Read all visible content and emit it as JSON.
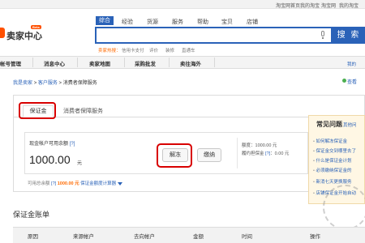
{
  "top_links": [
    "淘宝网首页",
    "我的淘宝",
    "淘宝网",
    "我的淘宝"
  ],
  "logo": {
    "text": "卖家中心",
    "badge": "Beta"
  },
  "search": {
    "tabs": [
      "综合",
      "经验",
      "货源",
      "服务",
      "帮助",
      "宝贝",
      "店铺"
    ],
    "button": "搜 索",
    "hot_label": "卖家热搜：",
    "hot_words": [
      "信用卡支付",
      "评价",
      "装修",
      "直通车"
    ]
  },
  "nav": {
    "items": [
      "帐号管理",
      "消息中心",
      "卖家地图",
      "采购批发",
      "卖往海外"
    ],
    "right_link": "我的"
  },
  "breadcrumb": [
    "我是卖家",
    "客户服务",
    "消费者保障服务"
  ],
  "help_link": "查看",
  "tabs": {
    "deposit": "保证金",
    "consumer": "消费者保障服务"
  },
  "account": {
    "available_label": "现金帐户可用余额",
    "available_hint": "[?]",
    "amount": "1000.00",
    "unit": "元",
    "unfreeze_button": "解冻",
    "pay_button": "缴纳",
    "quota_label": "额度：",
    "quota_value": "1000.00 元",
    "perform_label": "履约担保金",
    "perform_hint": "[?]",
    "perform_value": "：0.00 元"
  },
  "bottom": {
    "label": "可用总余额",
    "hint": "[?]",
    "amount": "1000.00 元",
    "calc_link": "保证金额度计算器"
  },
  "faq": {
    "title": "常见问题",
    "more": "其他问",
    "items": [
      "如何解冻保证金",
      "保证金交到哪里去了",
      "什么是保证金计划",
      "必须缴纳保证金的",
      "新消七天更换服务",
      "店铺保证金开始自动"
    ]
  },
  "ledger": {
    "title": "保证金账单",
    "columns": [
      "原因",
      "来源帐户",
      "去向帐户",
      "金额",
      "时间",
      "操作"
    ]
  },
  "colors": {
    "accent": "#2a62b8",
    "highlight_ring": "#d80000",
    "brand": "#ff5000"
  }
}
